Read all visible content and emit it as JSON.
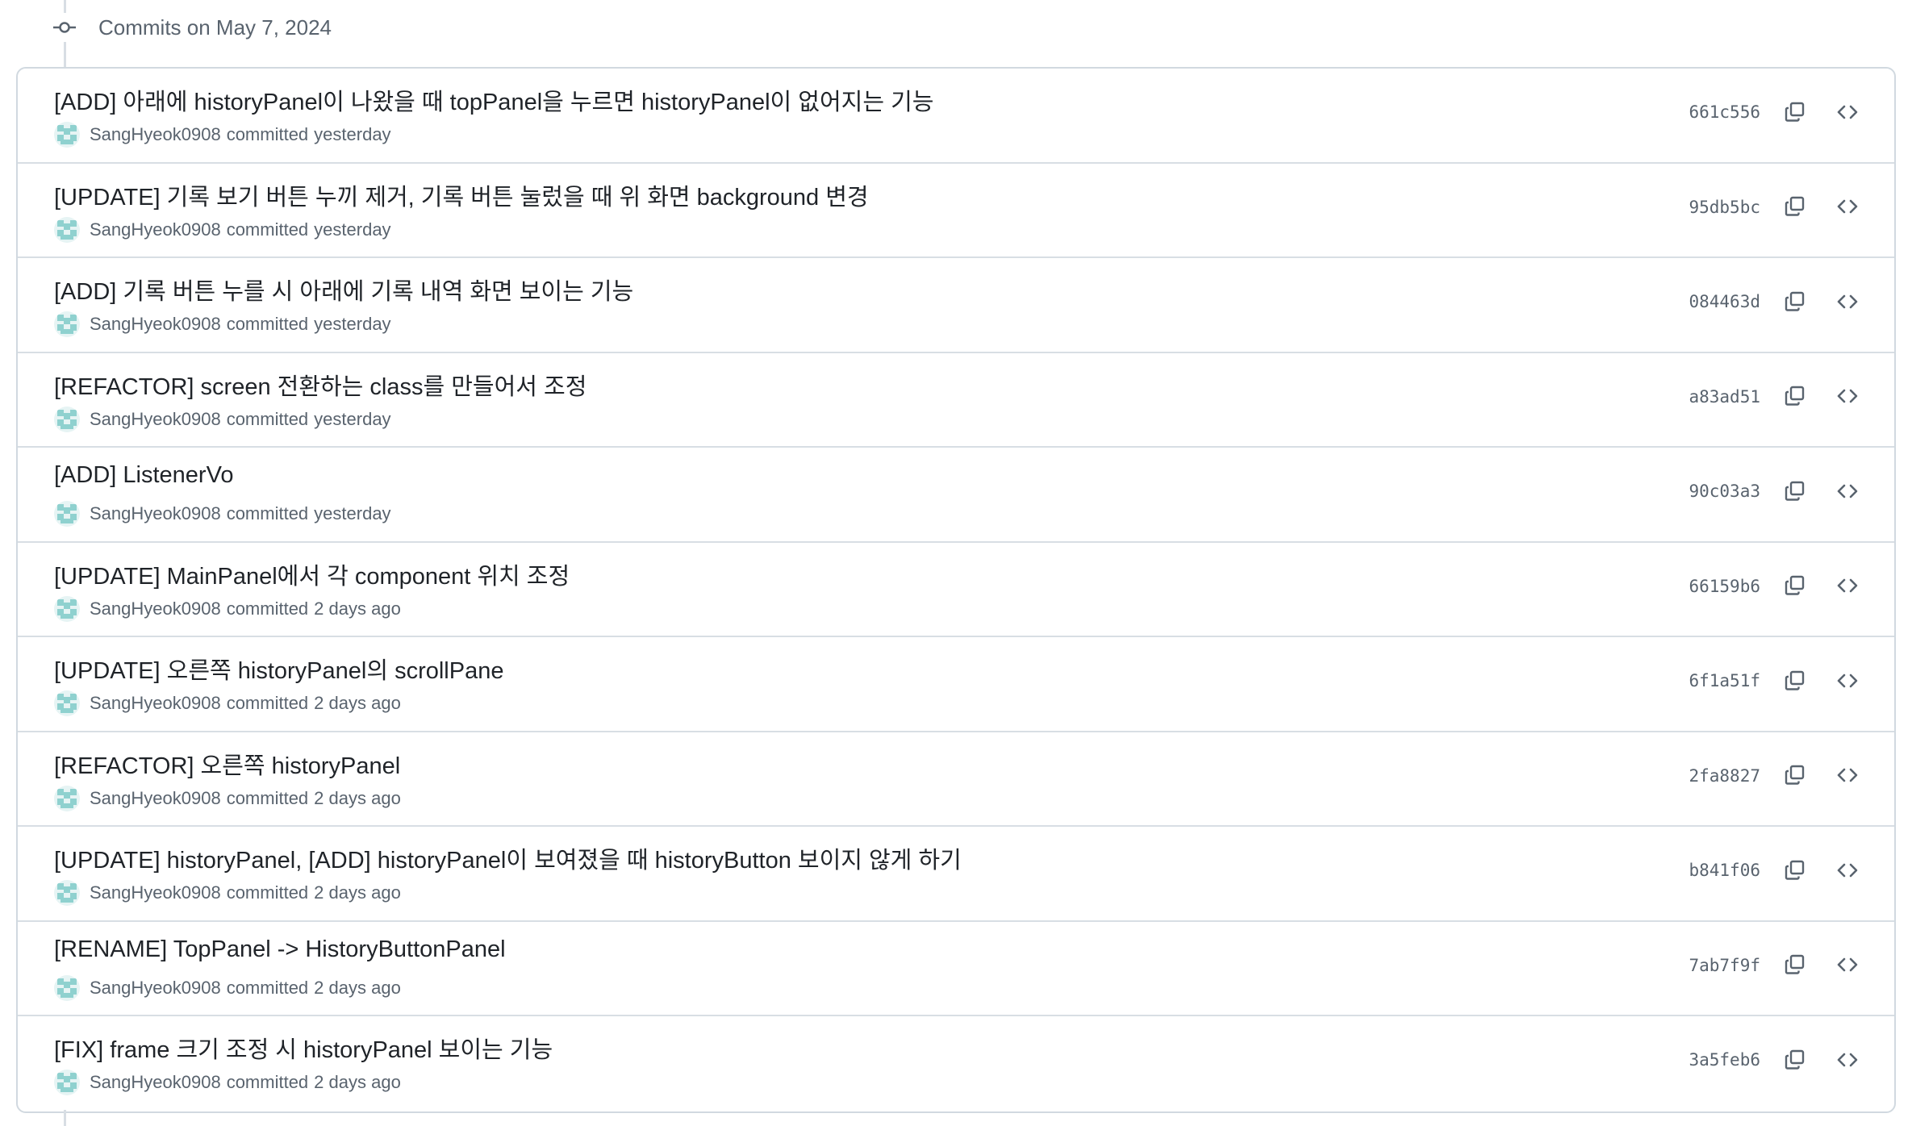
{
  "group": {
    "title": "Commits on May 7, 2024"
  },
  "commits": [
    {
      "title": "[ADD] 아래에 historyPanel이 나왔을 때 topPanel을 누르면 historyPanel이 없어지는 기능",
      "author": "SangHyeok0908",
      "action": "committed",
      "time": "yesterday",
      "sha": "661c556"
    },
    {
      "title": "[UPDATE] 기록 보기 버튼 누끼 제거, 기록 버튼 눌렀을 때 위 화면 background 변경",
      "author": "SangHyeok0908",
      "action": "committed",
      "time": "yesterday",
      "sha": "95db5bc"
    },
    {
      "title": "[ADD] 기록 버튼 누를 시 아래에 기록 내역 화면 보이는 기능",
      "author": "SangHyeok0908",
      "action": "committed",
      "time": "yesterday",
      "sha": "084463d"
    },
    {
      "title": "[REFACTOR] screen 전환하는 class를 만들어서 조정",
      "author": "SangHyeok0908",
      "action": "committed",
      "time": "yesterday",
      "sha": "a83ad51"
    },
    {
      "title": "[ADD] ListenerVo",
      "author": "SangHyeok0908",
      "action": "committed",
      "time": "yesterday",
      "sha": "90c03a3"
    },
    {
      "title": "[UPDATE] MainPanel에서 각 component 위치 조정",
      "author": "SangHyeok0908",
      "action": "committed",
      "time": "2 days ago",
      "sha": "66159b6"
    },
    {
      "title": "[UPDATE] 오른쪽 historyPanel의 scrollPane",
      "author": "SangHyeok0908",
      "action": "committed",
      "time": "2 days ago",
      "sha": "6f1a51f"
    },
    {
      "title": "[REFACTOR] 오른쪽 historyPanel",
      "author": "SangHyeok0908",
      "action": "committed",
      "time": "2 days ago",
      "sha": "2fa8827"
    },
    {
      "title": "[UPDATE] historyPanel, [ADD] historyPanel이 보여졌을 때 historyButton 보이지 않게 하기",
      "author": "SangHyeok0908",
      "action": "committed",
      "time": "2 days ago",
      "sha": "b841f06"
    },
    {
      "title": "[RENAME] TopPanel -> HistoryButtonPanel",
      "author": "SangHyeok0908",
      "action": "committed",
      "time": "2 days ago",
      "sha": "7ab7f9f"
    },
    {
      "title": "[FIX] frame 크기 조정 시 historyPanel 보이는 기능",
      "author": "SangHyeok0908",
      "action": "committed",
      "time": "2 days ago",
      "sha": "3a5feb6"
    }
  ],
  "icons": {
    "commit_node": "git-commit-icon",
    "copy": "copy-icon",
    "browse": "code-icon",
    "avatar": "identicon-avatar"
  },
  "colors": {
    "text_primary": "#1f2328",
    "text_muted": "#59636e",
    "border": "#d1d9e0",
    "avatar": "#8fd1cf"
  }
}
